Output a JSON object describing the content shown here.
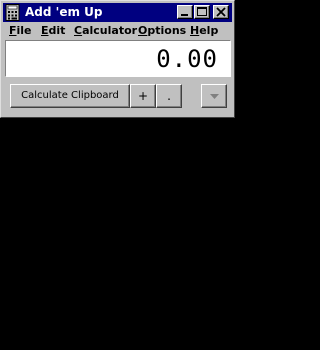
{
  "window": {
    "title": "Add 'em Up",
    "colors": {
      "titlebar": "#000080",
      "face": "#c0c0c0",
      "display_bg": "#ffffff",
      "desktop": "#000000"
    }
  },
  "titlebar_icons": {
    "app": "calculator-icon",
    "minimize": "minimize-icon",
    "maximize": "maximize-icon",
    "close": "close-icon"
  },
  "menu": {
    "items": [
      {
        "label": "File"
      },
      {
        "label": "Edit"
      },
      {
        "label": "Calculator"
      },
      {
        "label": "Options"
      },
      {
        "label": "Help"
      }
    ]
  },
  "display": {
    "value": "0.00"
  },
  "toolbar": {
    "calc_label": "Calculate Clipboard",
    "plus_label": "+",
    "dot_label": ".",
    "dropdown_icon": "chevron-down-icon"
  }
}
